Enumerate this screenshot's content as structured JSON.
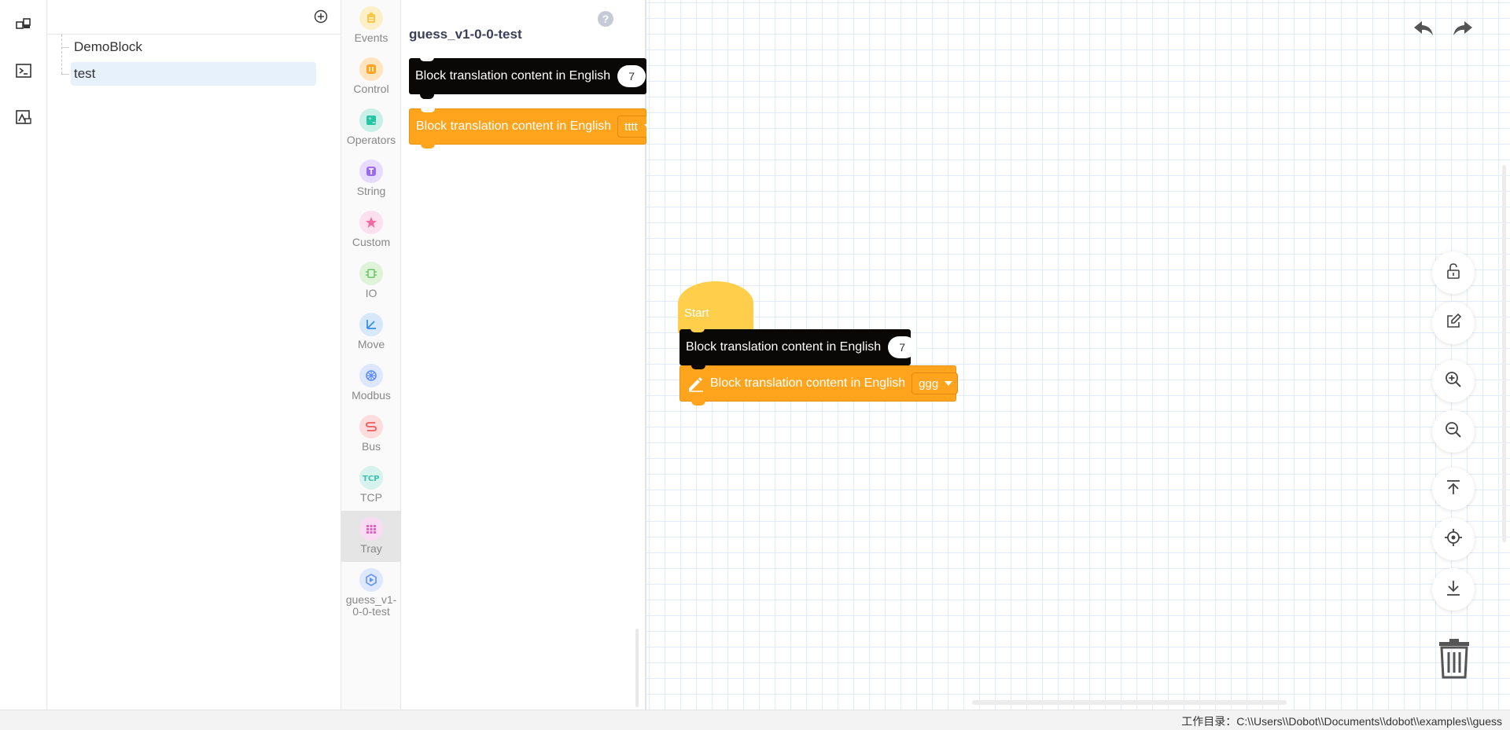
{
  "tree": {
    "items": [
      {
        "label": "DemoBlock"
      },
      {
        "label": "test",
        "selected": true
      }
    ]
  },
  "categories": [
    {
      "label": "Events",
      "icon": "events-icon",
      "color": "#f7c84a"
    },
    {
      "label": "Control",
      "icon": "control-icon",
      "color": "#ffa41c"
    },
    {
      "label": "Operators",
      "icon": "operators-icon",
      "color": "#27c4a4"
    },
    {
      "label": "String",
      "icon": "string-icon",
      "color": "#9b6cf0"
    },
    {
      "label": "Custom",
      "icon": "custom-icon",
      "color": "#f36aa5"
    },
    {
      "label": "IO",
      "icon": "io-icon",
      "color": "#6cc36c"
    },
    {
      "label": "Move",
      "icon": "move-icon",
      "color": "#3a8ee6"
    },
    {
      "label": "Modbus",
      "icon": "modbus-icon",
      "color": "#5b8cf7"
    },
    {
      "label": "Bus",
      "icon": "bus-icon",
      "color": "#f05a5a"
    },
    {
      "label": "TCP",
      "icon": "tcp-icon",
      "color": "#3fc1b0"
    },
    {
      "label": "Tray",
      "icon": "tray-icon",
      "color": "#e063c2",
      "active": true
    },
    {
      "label": "guess_v1-0-0-test",
      "icon": "extension-icon",
      "color": "#5b8cf7"
    }
  ],
  "flyout": {
    "title": "guess_v1-0-0-test",
    "help": "?",
    "blocks": [
      {
        "text": "Block translation content in English",
        "value": "7"
      },
      {
        "text": "Block translation content in English",
        "dropdown": "tttt"
      }
    ]
  },
  "workspace": {
    "hat_label": "Start",
    "blocks": [
      {
        "text": "Block translation content in English",
        "value": "7"
      },
      {
        "text": "Block translation content in English",
        "dropdown": "ggg"
      }
    ]
  },
  "status": {
    "text": "工作目录：C:\\\\Users\\\\Dobot\\\\Documents\\\\dobot\\\\examples\\\\guess"
  },
  "colors": {
    "accent": "#ffa41c",
    "block_dark": "#0a0707",
    "hat": "#ffce4a",
    "selection": "#e6f1fb"
  }
}
